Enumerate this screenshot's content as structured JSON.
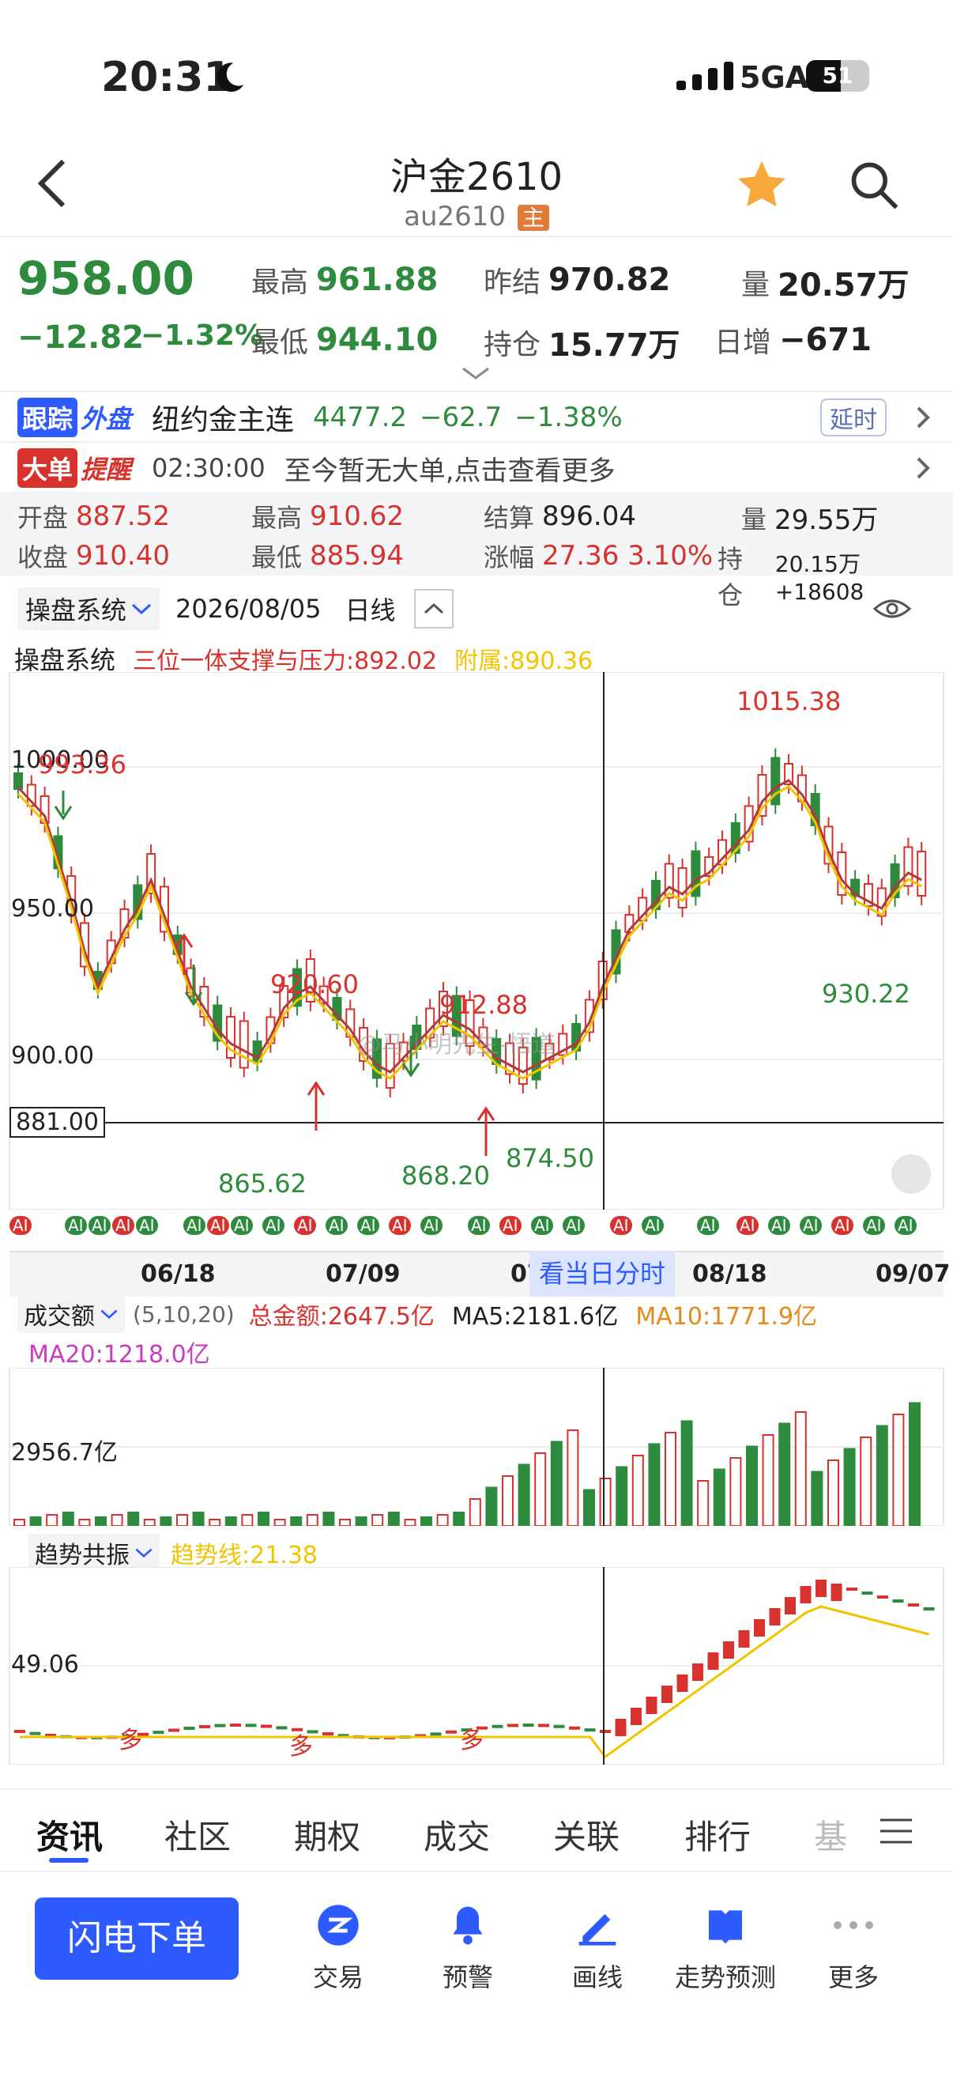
{
  "status_bar": {
    "time": "20:31",
    "network": "5GA",
    "battery": "51"
  },
  "header": {
    "title": "沪金2610",
    "code": "au2610",
    "badge": "主"
  },
  "quote": {
    "price": "958.00",
    "change": "−12.82",
    "change_pct": "−1.32%",
    "high_label": "最高",
    "high": "961.88",
    "low_label": "最低",
    "low": "944.10",
    "prev_settle_label": "昨结",
    "prev_settle": "970.82",
    "open_int_label": "持仓",
    "open_int": "15.77万",
    "volume_label": "量",
    "volume": "20.57万",
    "daily_inc_label": "日增",
    "daily_inc": "−671"
  },
  "foreign": {
    "tag1": "跟踪",
    "tag2": "外盘",
    "name": "纽约金主连",
    "price": "4477.2",
    "change": "−62.7",
    "change_pct": "−1.38%",
    "delay": "延时"
  },
  "bigorder": {
    "tag1": "大单",
    "tag2": "提醒",
    "time": "02:30:00",
    "text": "至今暂无大单,点击查看更多"
  },
  "day_stats": {
    "open_label": "开盘",
    "open": "887.52",
    "close_label": "收盘",
    "close": "910.40",
    "high_label": "最高",
    "high": "910.62",
    "low_label": "最低",
    "low": "885.94",
    "settle_label": "结算",
    "settle": "896.04",
    "range_label": "涨幅",
    "range": "27.36 3.10%",
    "vol_label": "量",
    "vol": "29.55万",
    "oi_label": "持仓",
    "oi": "20.15万 +18608"
  },
  "chart_toolbar": {
    "system": "操盘系统",
    "date": "2026/08/05",
    "period": "日线"
  },
  "legend": {
    "name": "操盘系统",
    "support": "三位一体支撑与压力:892.02",
    "sub": "附属:890.36"
  },
  "main_chart": {
    "y_labels": [
      "1000.00",
      "950.00",
      "900.00"
    ],
    "crosshair_price": "881.00",
    "annotations": {
      "a1": "993.36",
      "a2": "920.60",
      "a3": "912.88",
      "a4": "1015.38",
      "a5": "865.62",
      "a6": "868.20",
      "a7": "874.50",
      "a8": "930.22"
    },
    "watermark": "@马小明先生-悟道",
    "x_labels": [
      "06/18",
      "07/09",
      "07",
      "08/18",
      "09/07"
    ],
    "intraday_btn": "看当日分时",
    "ai_tag": "AI"
  },
  "volume_panel": {
    "selector": "成交额",
    "params": "(5,10,20)",
    "total": "总金额:2647.5亿",
    "ma5": "MA5:2181.6亿",
    "ma10": "MA10:1771.9亿",
    "ma20": "MA20:1218.0亿",
    "y_label": "2956.7亿"
  },
  "trend_panel": {
    "selector": "趋势共振",
    "line": "趋势线:21.38",
    "y_label": "49.06",
    "duo": "多"
  },
  "tabs": [
    "资讯",
    "社区",
    "期权",
    "成交",
    "关联",
    "排行",
    "基"
  ],
  "bottom": {
    "order_btn": "闪电下单",
    "tools": [
      "交易",
      "预警",
      "画线",
      "走势预测",
      "更多"
    ]
  },
  "colors": {
    "up": "#d8322e",
    "down": "#2e8b3d",
    "accent": "#2e5bff",
    "ma_yellow": "#f2c400"
  }
}
